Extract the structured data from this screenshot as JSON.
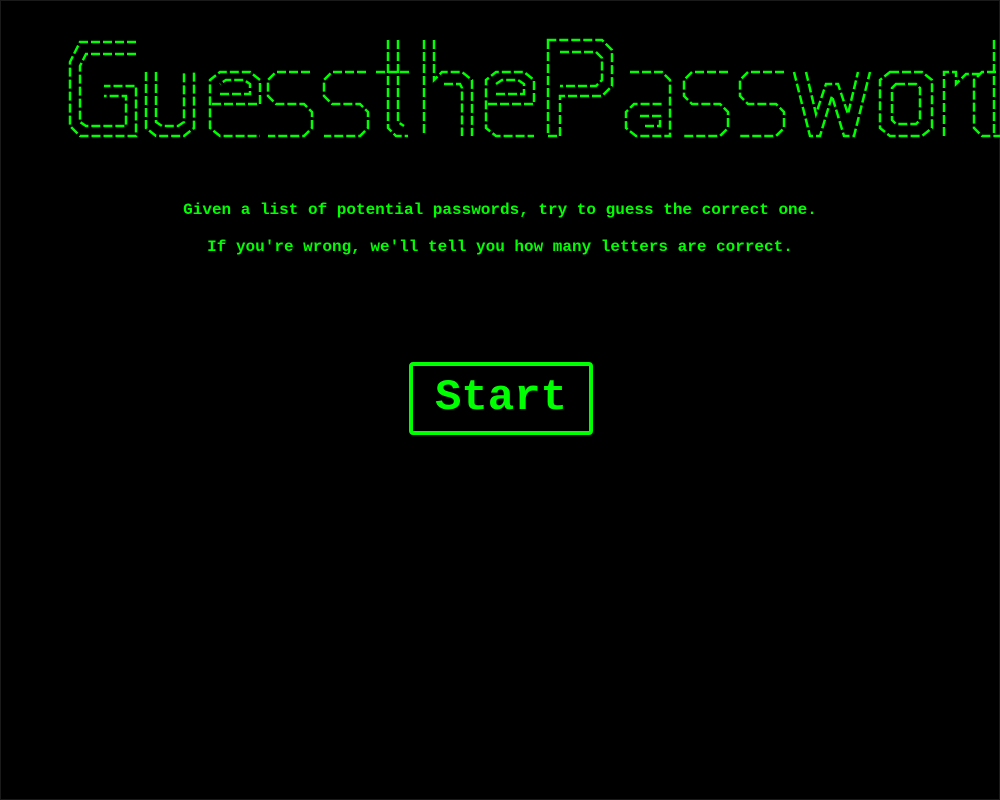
{
  "title": {
    "text": "Guess the Password",
    "color": "#00ff00"
  },
  "intro": {
    "line1": "Given a list of potential passwords, try to guess the correct one.",
    "line2": "If you're wrong, we'll tell you how many letters are correct."
  },
  "start_button": {
    "label": "Start"
  },
  "colors": {
    "background": "#000000",
    "accent": "#00ff00"
  }
}
